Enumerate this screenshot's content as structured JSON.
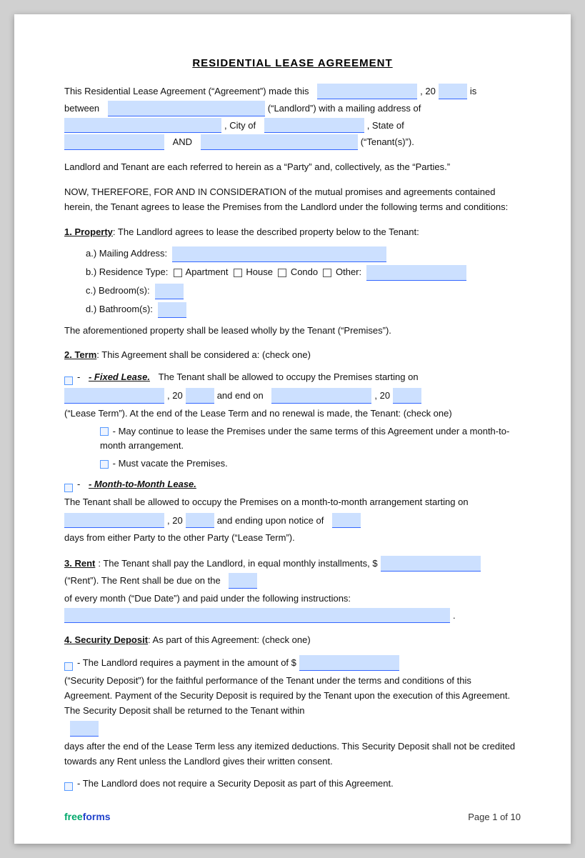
{
  "title": "RESIDENTIAL LEASE AGREEMENT",
  "intro": {
    "line1a": "This Residential Lease Agreement (“Agreement”) made this",
    "line1b": ", 20",
    "line1c": "is",
    "line2a": "between",
    "line2b": "(“Landlord”) with a mailing address of",
    "line3a": ", City of",
    "line3b": ", State of",
    "line4a": "AND",
    "line4b": "(“Tenant(s)”)."
  },
  "parties_note": "Landlord and Tenant are each referred to herein as a “Party” and, collectively, as the “Parties.”",
  "consideration": "NOW, THEREFORE, FOR AND IN CONSIDERATION of the mutual promises and agreements contained herein, the Tenant agrees to lease the Premises from the Landlord under the following terms and conditions:",
  "section1": {
    "heading": "1. Property",
    "text": ": The Landlord agrees to lease the described property below to the Tenant:",
    "a_label": "a.)  Mailing Address:",
    "b_label": "b.)  Residence Type:",
    "b_apartment": "Apartment",
    "b_house": "House",
    "b_condo": "Condo",
    "b_other": "Other:",
    "c_label": "c.)  Bedroom(s):",
    "d_label": "d.)  Bathroom(s):",
    "closing": "The aforementioned property shall be leased wholly by the Tenant (“Premises”)."
  },
  "section2": {
    "heading": "2. Term",
    "text": ": This Agreement shall be considered a: (check one)",
    "fixed_lease_label": "- Fixed Lease.",
    "fixed_lease_text": "The Tenant shall be allowed to occupy the Premises starting on",
    "fixed_lease_text2": ", 20",
    "fixed_lease_text3": "and end on",
    "fixed_lease_text4": ", 20",
    "fixed_lease_text5": "(“Lease Term”). At the end of the Lease Term and no renewal is made, the Tenant: (check one)",
    "option1": "- May continue to lease the Premises under the same terms of this Agreement under a month-to-month arrangement.",
    "option2": "- Must vacate the Premises.",
    "month_label": "- Month-to-Month Lease.",
    "month_text": "The Tenant shall be allowed to occupy the Premises on a month-to-month arrangement starting on",
    "month_text2": ", 20",
    "month_text3": "and ending upon notice of",
    "month_text4": "days from either Party to the other Party (“Lease Term”)."
  },
  "section3": {
    "heading": "3. Rent",
    "text": ": The Tenant shall pay the Landlord, in equal monthly installments, $",
    "text2": "(“Rent”). The Rent shall be due on the",
    "text3": "of every month (“Due Date”) and paid under the following instructions:",
    "text4": "."
  },
  "section4": {
    "heading": "4. Security Deposit",
    "text": ": As part of this Agreement: (check one)",
    "option1_text": "- The Landlord requires a payment in the amount of $",
    "option1_text2": "(“Security Deposit”) for the faithful performance of the Tenant under the terms and conditions of this Agreement. Payment of the Security Deposit is required by the Tenant upon the execution of this Agreement. The Security Deposit shall be returned to the Tenant within",
    "option1_text3": "days after the end of the Lease Term less any itemized deductions. This Security Deposit shall not be credited towards any Rent unless the Landlord gives their written consent.",
    "option2_text": "- The Landlord does not require a Security Deposit as part of this Agreement."
  },
  "footer": {
    "logo_free": "free",
    "logo_forms": "forms",
    "page": "Page 1 of 10"
  }
}
